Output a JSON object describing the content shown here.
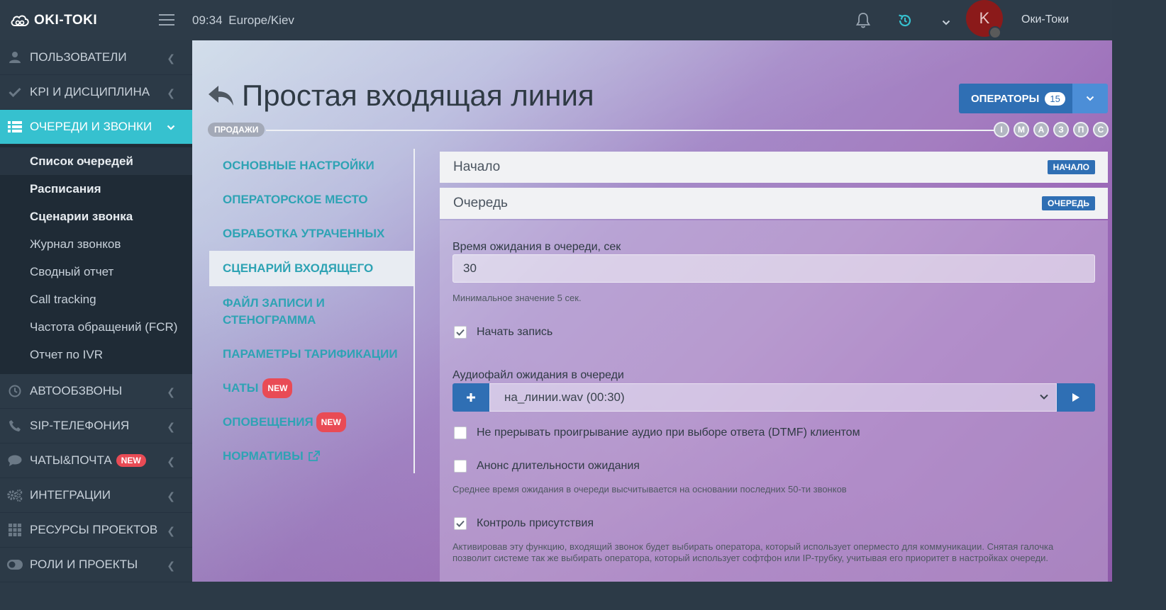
{
  "header": {
    "logo_text": "OKI-TOKI",
    "time": "09:34",
    "timezone": "Europe/Kiev",
    "avatar_letter": "K",
    "user_name": "Оки-Токи"
  },
  "sidebar": {
    "items": [
      {
        "label": "ПОЛЬЗОВАТЕЛИ",
        "icon": "user-icon"
      },
      {
        "label": "KPI И ДИСЦИПЛИНА",
        "icon": "check-icon"
      },
      {
        "label": "ОЧЕРЕДИ И ЗВОНКИ",
        "icon": "list-icon"
      },
      {
        "label": "АВТООБЗВОНЫ",
        "icon": "clock-icon"
      },
      {
        "label": "SIP-ТЕЛЕФОНИЯ",
        "icon": "phone-icon"
      },
      {
        "label": "ЧАТЫ&ПОЧТА",
        "icon": "chat-icon",
        "badge": "NEW"
      },
      {
        "label": "ИНТЕГРАЦИИ",
        "icon": "gears-icon"
      },
      {
        "label": "РЕСУРСЫ ПРОЕКТОВ",
        "icon": "grid-icon"
      },
      {
        "label": "РОЛИ И ПРОЕКТЫ",
        "icon": "toggle-icon"
      }
    ],
    "submenu": [
      "Список очередей",
      "Расписания",
      "Сценарии звонка",
      "Журнал звонков",
      "Сводный отчет",
      "Call tracking",
      "Частота обращений (FCR)",
      "Отчет по IVR"
    ]
  },
  "page": {
    "title": "Простая входящая линия",
    "project_pill": "ПРОДАЖИ",
    "steps": [
      "I",
      "M",
      "A",
      "З",
      "П",
      "C"
    ],
    "operators_label": "ОПЕРАТОРЫ",
    "operators_count": "15"
  },
  "tabs": {
    "basic": "ОСНОВНЫЕ НАСТРОЙКИ",
    "operator_place": "ОПЕРАТОРСКОЕ МЕСТО",
    "lost_handling": "ОБРАБОТКА УТРАЧЕННЫХ",
    "incoming_scenario": "СЦЕНАРИЙ ВХОДЯЩЕГО",
    "recording_line1": "ФАЙЛ ЗАПИСИ И",
    "recording_line2": "СТЕНОГРАММА",
    "tariff": "ПАРАМЕТРЫ ТАРИФИКАЦИИ",
    "chats": "ЧАТЫ",
    "notifications": "ОПОВЕЩЕНИЯ",
    "norms": "НОРМАТИВЫ",
    "new_badge": "NEW"
  },
  "panels": {
    "start_title": "Начало",
    "start_tag": "НАЧАЛО",
    "queue_title": "Очередь",
    "queue_tag": "ОЧЕРЕДЬ"
  },
  "form": {
    "wait_label": "Время ожидания в очереди, сек",
    "wait_value": "30",
    "wait_hint": "Минимальное значение 5 сек.",
    "start_record_label": "Начать запись",
    "start_record_checked": true,
    "audio_label": "Аудиофайл ожидания в очереди",
    "audio_value": "на_линии.wav (00:30)",
    "no_interrupt_label": "Не прерывать проигрывание аудио при выборе ответа (DTMF) клиентом",
    "no_interrupt_checked": false,
    "announce_label": "Анонс длительности ожидания",
    "announce_checked": false,
    "announce_hint": "Среднее время ожидания в очереди высчитывается на основании последних 50-ти звонков",
    "presence_label": "Контроль присутствия",
    "presence_checked": true,
    "presence_hint": "Активировав эту функцию, входящий звонок будет выбирать оператора, который использует оперместо для коммуникации. Снятая галочка позволит системе так же выбирать оператора, который использует софтфон или IP-трубку, учитывая его приоритет в настройках очереди."
  },
  "colors": {
    "sidebar_bg": "#2c3a47",
    "accent_cyan": "#36c1cf",
    "primary_blue": "#2f6fb4",
    "badge_red": "#e94b55",
    "tab_text": "#2ea3b4"
  }
}
